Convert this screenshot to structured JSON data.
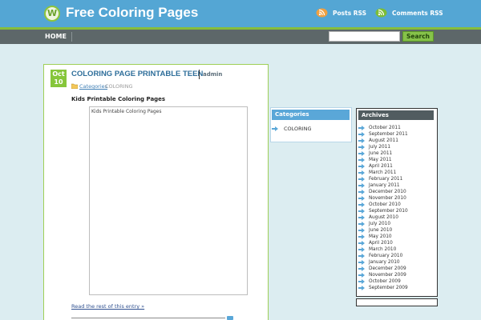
{
  "header": {
    "site_title": "Free Coloring Pages",
    "logo_icon": "wordpress-logo",
    "posts_rss": "Posts RSS",
    "comments_rss": "Comments RSS"
  },
  "nav": {
    "home": "HOME",
    "search_button": "Search",
    "search_value": ""
  },
  "post": {
    "date_month": "Oct",
    "date_day": "10",
    "title": "COLORING PAGE PRINTABLE TEEN",
    "author": "admin",
    "categories_label": "Categories",
    "category": "COLORING",
    "heading": "Kids Printable Coloring Pages",
    "image_alt": "Kids Printable Coloring Pages",
    "read_more": "Read the rest of this entry »"
  },
  "sidebar": {
    "categories_title": "Categories",
    "categories": [
      "COLORING"
    ],
    "archives_title": "Archives",
    "archives": [
      "October 2011",
      "September 2011",
      "August 2011",
      "July 2011",
      "June 2011",
      "May 2011",
      "April 2011",
      "March 2011",
      "February 2011",
      "January 2011",
      "December 2010",
      "November 2010",
      "October 2010",
      "September 2010",
      "August 2010",
      "July 2010",
      "June 2010",
      "May 2010",
      "April 2010",
      "March 2010",
      "February 2010",
      "January 2010",
      "December 2009",
      "November 2009",
      "October 2009",
      "September 2009"
    ]
  },
  "colors": {
    "header_bg": "#54a6d4",
    "accent_green": "#86bd3c",
    "nav_bg": "#5d6769",
    "page_bg": "#dcedf1"
  }
}
